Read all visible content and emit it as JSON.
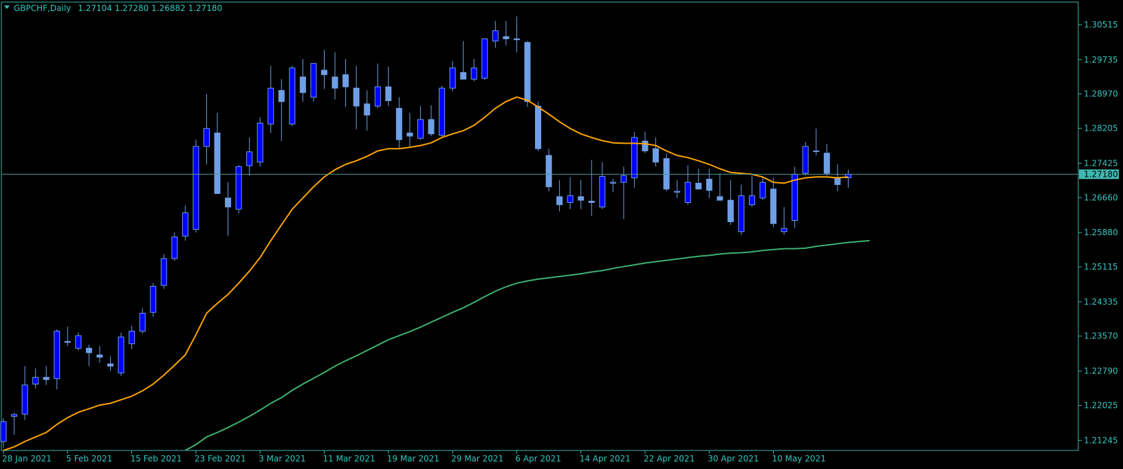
{
  "header": {
    "symbol": "GBPCHF,Daily",
    "ohlc": "1.27104 1.27280 1.26882 1.27180"
  },
  "colors": {
    "background": "#000000",
    "frame": "#3fb8b0",
    "text": "#30c8c0",
    "bull_candle": "#0000ff",
    "bear_candle": "#6f9fe6",
    "wick": "#6f9fe6",
    "ma_fast": "#ffa500",
    "ma_slow": "#3cb371",
    "price_line": "#4a9a9a",
    "price_label_bg": "#3fb8b0",
    "price_label_text": "#000000"
  },
  "chart_data": {
    "type": "candlestick",
    "y_axis_ticks": [
      "1.30515",
      "1.29735",
      "1.28970",
      "1.28205",
      "1.27425",
      "1.26660",
      "1.25880",
      "1.25115",
      "1.24335",
      "1.23570",
      "1.22790",
      "1.22025",
      "1.21245"
    ],
    "x_axis_labels": [
      "28 Jan 2021",
      "5 Feb 2021",
      "15 Feb 2021",
      "23 Feb 2021",
      "3 Mar 2021",
      "11 Mar 2021",
      "19 Mar 2021",
      "29 Mar 2021",
      "6 Apr 2021",
      "14 Apr 2021",
      "22 Apr 2021",
      "30 Apr 2021",
      "10 May 2021"
    ],
    "x_axis_label_bar_index": [
      0,
      6,
      12,
      18,
      24,
      30,
      36,
      42,
      48,
      54,
      60,
      66,
      72
    ],
    "ylim": [
      1.2102,
      1.3102
    ],
    "current_price": "1.27180",
    "candles": [
      {
        "o": 1.2122,
        "h": 1.2174,
        "l": 1.2108,
        "c": 1.2166
      },
      {
        "o": 1.2178,
        "h": 1.2186,
        "l": 1.2137,
        "c": 1.2182
      },
      {
        "o": 1.2183,
        "h": 1.229,
        "l": 1.217,
        "c": 1.2248
      },
      {
        "o": 1.225,
        "h": 1.2285,
        "l": 1.224,
        "c": 1.2265
      },
      {
        "o": 1.2265,
        "h": 1.229,
        "l": 1.2248,
        "c": 1.226
      },
      {
        "o": 1.2262,
        "h": 1.2372,
        "l": 1.2238,
        "c": 1.2368
      },
      {
        "o": 1.2345,
        "h": 1.2378,
        "l": 1.2335,
        "c": 1.2343
      },
      {
        "o": 1.233,
        "h": 1.2365,
        "l": 1.2325,
        "c": 1.2358
      },
      {
        "o": 1.233,
        "h": 1.2338,
        "l": 1.229,
        "c": 1.232
      },
      {
        "o": 1.2315,
        "h": 1.2335,
        "l": 1.2298,
        "c": 1.231
      },
      {
        "o": 1.2295,
        "h": 1.2312,
        "l": 1.228,
        "c": 1.229
      },
      {
        "o": 1.2275,
        "h": 1.2365,
        "l": 1.2268,
        "c": 1.2355
      },
      {
        "o": 1.234,
        "h": 1.238,
        "l": 1.2328,
        "c": 1.2368
      },
      {
        "o": 1.2368,
        "h": 1.242,
        "l": 1.2362,
        "c": 1.2408
      },
      {
        "o": 1.241,
        "h": 1.2475,
        "l": 1.24,
        "c": 1.2468
      },
      {
        "o": 1.247,
        "h": 1.254,
        "l": 1.2462,
        "c": 1.253
      },
      {
        "o": 1.253,
        "h": 1.2588,
        "l": 1.2525,
        "c": 1.2578
      },
      {
        "o": 1.258,
        "h": 1.2648,
        "l": 1.257,
        "c": 1.2632
      },
      {
        "o": 1.2595,
        "h": 1.2795,
        "l": 1.2588,
        "c": 1.278
      },
      {
        "o": 1.278,
        "h": 1.2897,
        "l": 1.274,
        "c": 1.282
      },
      {
        "o": 1.281,
        "h": 1.2855,
        "l": 1.2675,
        "c": 1.2675
      },
      {
        "o": 1.2665,
        "h": 1.27,
        "l": 1.258,
        "c": 1.2645
      },
      {
        "o": 1.264,
        "h": 1.2738,
        "l": 1.263,
        "c": 1.2735
      },
      {
        "o": 1.2737,
        "h": 1.28,
        "l": 1.2715,
        "c": 1.2768
      },
      {
        "o": 1.2745,
        "h": 1.2845,
        "l": 1.2735,
        "c": 1.2832
      },
      {
        "o": 1.283,
        "h": 1.296,
        "l": 1.281,
        "c": 1.291
      },
      {
        "o": 1.2905,
        "h": 1.293,
        "l": 1.2792,
        "c": 1.288
      },
      {
        "o": 1.283,
        "h": 1.296,
        "l": 1.2825,
        "c": 1.2955
      },
      {
        "o": 1.2935,
        "h": 1.2975,
        "l": 1.288,
        "c": 1.29
      },
      {
        "o": 1.289,
        "h": 1.2965,
        "l": 1.288,
        "c": 1.2965
      },
      {
        "o": 1.295,
        "h": 1.2995,
        "l": 1.2908,
        "c": 1.294
      },
      {
        "o": 1.2935,
        "h": 1.299,
        "l": 1.2885,
        "c": 1.291
      },
      {
        "o": 1.294,
        "h": 1.2975,
        "l": 1.2868,
        "c": 1.2913
      },
      {
        "o": 1.291,
        "h": 1.296,
        "l": 1.2818,
        "c": 1.287
      },
      {
        "o": 1.2875,
        "h": 1.2905,
        "l": 1.2815,
        "c": 1.285
      },
      {
        "o": 1.287,
        "h": 1.2965,
        "l": 1.2865,
        "c": 1.2913
      },
      {
        "o": 1.2913,
        "h": 1.2958,
        "l": 1.287,
        "c": 1.2882
      },
      {
        "o": 1.2865,
        "h": 1.289,
        "l": 1.2775,
        "c": 1.2795
      },
      {
        "o": 1.281,
        "h": 1.2855,
        "l": 1.278,
        "c": 1.2803
      },
      {
        "o": 1.2798,
        "h": 1.287,
        "l": 1.2795,
        "c": 1.284
      },
      {
        "o": 1.284,
        "h": 1.2872,
        "l": 1.2803,
        "c": 1.2808
      },
      {
        "o": 1.2805,
        "h": 1.2915,
        "l": 1.2802,
        "c": 1.291
      },
      {
        "o": 1.291,
        "h": 1.297,
        "l": 1.2903,
        "c": 1.2955
      },
      {
        "o": 1.2945,
        "h": 1.3015,
        "l": 1.293,
        "c": 1.293
      },
      {
        "o": 1.293,
        "h": 1.2975,
        "l": 1.2925,
        "c": 1.2955
      },
      {
        "o": 1.2932,
        "h": 1.3005,
        "l": 1.2928,
        "c": 1.302
      },
      {
        "o": 1.3015,
        "h": 1.306,
        "l": 1.3,
        "c": 1.3038
      },
      {
        "o": 1.3025,
        "h": 1.306,
        "l": 1.3005,
        "c": 1.302
      },
      {
        "o": 1.302,
        "h": 1.307,
        "l": 1.299,
        "c": 1.3018
      },
      {
        "o": 1.3012,
        "h": 1.3015,
        "l": 1.2868,
        "c": 1.288
      },
      {
        "o": 1.287,
        "h": 1.288,
        "l": 1.277,
        "c": 1.2775
      },
      {
        "o": 1.276,
        "h": 1.2775,
        "l": 1.268,
        "c": 1.269
      },
      {
        "o": 1.2668,
        "h": 1.2705,
        "l": 1.2635,
        "c": 1.265
      },
      {
        "o": 1.2655,
        "h": 1.2712,
        "l": 1.264,
        "c": 1.267
      },
      {
        "o": 1.2668,
        "h": 1.2705,
        "l": 1.264,
        "c": 1.266
      },
      {
        "o": 1.2658,
        "h": 1.275,
        "l": 1.2625,
        "c": 1.2655
      },
      {
        "o": 1.2645,
        "h": 1.2745,
        "l": 1.264,
        "c": 1.2713
      },
      {
        "o": 1.2698,
        "h": 1.2708,
        "l": 1.2678,
        "c": 1.27
      },
      {
        "o": 1.27,
        "h": 1.2735,
        "l": 1.2618,
        "c": 1.2715
      },
      {
        "o": 1.271,
        "h": 1.2812,
        "l": 1.2688,
        "c": 1.28
      },
      {
        "o": 1.2792,
        "h": 1.2813,
        "l": 1.2765,
        "c": 1.277
      },
      {
        "o": 1.2775,
        "h": 1.28,
        "l": 1.2735,
        "c": 1.2745
      },
      {
        "o": 1.2753,
        "h": 1.2765,
        "l": 1.268,
        "c": 1.2685
      },
      {
        "o": 1.2678,
        "h": 1.2705,
        "l": 1.2665,
        "c": 1.268
      },
      {
        "o": 1.2655,
        "h": 1.2738,
        "l": 1.265,
        "c": 1.27
      },
      {
        "o": 1.2698,
        "h": 1.273,
        "l": 1.2685,
        "c": 1.2685
      },
      {
        "o": 1.2707,
        "h": 1.273,
        "l": 1.2665,
        "c": 1.2682
      },
      {
        "o": 1.2668,
        "h": 1.272,
        "l": 1.266,
        "c": 1.266
      },
      {
        "o": 1.266,
        "h": 1.2705,
        "l": 1.2605,
        "c": 1.2612
      },
      {
        "o": 1.259,
        "h": 1.2695,
        "l": 1.2583,
        "c": 1.267
      },
      {
        "o": 1.265,
        "h": 1.2715,
        "l": 1.2645,
        "c": 1.267
      },
      {
        "o": 1.2665,
        "h": 1.2713,
        "l": 1.266,
        "c": 1.27
      },
      {
        "o": 1.2685,
        "h": 1.271,
        "l": 1.26,
        "c": 1.2608
      },
      {
        "o": 1.259,
        "h": 1.2645,
        "l": 1.2583,
        "c": 1.2597
      },
      {
        "o": 1.2615,
        "h": 1.2735,
        "l": 1.2598,
        "c": 1.2718
      },
      {
        "o": 1.272,
        "h": 1.279,
        "l": 1.2715,
        "c": 1.278
      },
      {
        "o": 1.277,
        "h": 1.282,
        "l": 1.276,
        "c": 1.277
      },
      {
        "o": 1.2765,
        "h": 1.2785,
        "l": 1.2715,
        "c": 1.272
      },
      {
        "o": 1.271,
        "h": 1.274,
        "l": 1.268,
        "c": 1.2695
      },
      {
        "o": 1.271,
        "h": 1.2728,
        "l": 1.2688,
        "c": 1.2718
      }
    ],
    "series": [
      {
        "values": [
          1.2102,
          1.211,
          1.2122,
          1.2132,
          1.2142,
          1.216,
          1.2175,
          1.2187,
          1.2195,
          1.2203,
          1.2207,
          1.2215,
          1.2223,
          1.2235,
          1.225,
          1.227,
          1.2292,
          1.2315,
          1.236,
          1.2408,
          1.243,
          1.245,
          1.2475,
          1.2502,
          1.2532,
          1.257,
          1.2605,
          1.264,
          1.2665,
          1.269,
          1.2712,
          1.2728,
          1.274,
          1.2748,
          1.2758,
          1.277,
          1.2775,
          1.2775,
          1.2778,
          1.2782,
          1.2788,
          1.28,
          1.2808,
          1.2815,
          1.2827,
          1.2845,
          1.2865,
          1.288,
          1.289,
          1.2883,
          1.2868,
          1.2852,
          1.2835,
          1.282,
          1.2808,
          1.28,
          1.2793,
          1.2788,
          1.2787,
          1.2787,
          1.2786,
          1.2782,
          1.277,
          1.276,
          1.2755,
          1.2748,
          1.274,
          1.273,
          1.2722,
          1.272,
          1.2718,
          1.2712,
          1.27,
          1.2698,
          1.2705,
          1.271,
          1.2712,
          1.2712,
          1.271,
          1.2712
        ]
      },
      {
        "values": [
          null,
          null,
          null,
          null,
          null,
          null,
          null,
          null,
          null,
          null,
          null,
          null,
          null,
          null,
          null,
          null,
          null,
          1.2102,
          1.2115,
          1.2132,
          1.2142,
          1.2153,
          1.2165,
          1.2178,
          1.2192,
          1.2207,
          1.222,
          1.2236,
          1.225,
          1.2263,
          1.2276,
          1.229,
          1.2302,
          1.2313,
          1.2325,
          1.2337,
          1.2349,
          1.2358,
          1.2367,
          1.2377,
          1.2388,
          1.2399,
          1.241,
          1.242,
          1.2432,
          1.2445,
          1.2457,
          1.2467,
          1.2475,
          1.248,
          1.2484,
          1.2487,
          1.249,
          1.2493,
          1.2496,
          1.25,
          1.2503,
          1.2508,
          1.2512,
          1.2516,
          1.252,
          1.2523,
          1.2526,
          1.2529,
          1.2532,
          1.2535,
          1.2537,
          1.254,
          1.2542,
          1.2543,
          1.2545,
          1.2548,
          1.255,
          1.2552,
          1.2552,
          1.2553,
          1.2557,
          1.256,
          1.2563,
          1.2566,
          1.2568,
          1.257
        ]
      }
    ]
  }
}
